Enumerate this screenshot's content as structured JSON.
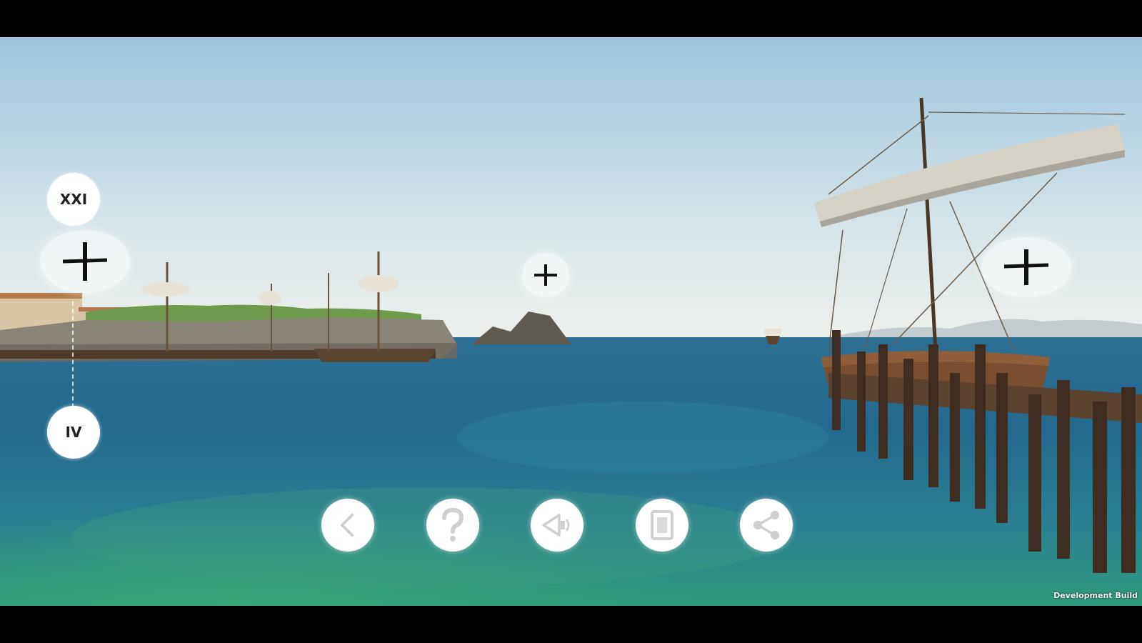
{
  "timeline": {
    "top_label": "XXI",
    "bottom_label": "IV"
  },
  "hotspots": [
    {
      "name": "hotspot-left",
      "icon": "plus-icon"
    },
    {
      "name": "hotspot-center",
      "icon": "plus-icon"
    },
    {
      "name": "hotspot-right",
      "icon": "plus-icon"
    }
  ],
  "toolbar": [
    {
      "name": "back-button",
      "icon": "chevron-left-icon"
    },
    {
      "name": "help-button",
      "icon": "question-mark-icon"
    },
    {
      "name": "audio-button",
      "icon": "speaker-icon"
    },
    {
      "name": "info-button",
      "icon": "document-icon"
    },
    {
      "name": "share-button",
      "icon": "share-icon"
    }
  ],
  "footer": {
    "build_label": "Development Build"
  },
  "colors": {
    "sky_top": "#9fc6dd",
    "sky_horizon": "#e9efea",
    "sea_deep": "#1f5f86",
    "sea_shallow": "#2e8f86",
    "button_bg": "#ffffff",
    "icon_color": "#cfcfcf"
  }
}
